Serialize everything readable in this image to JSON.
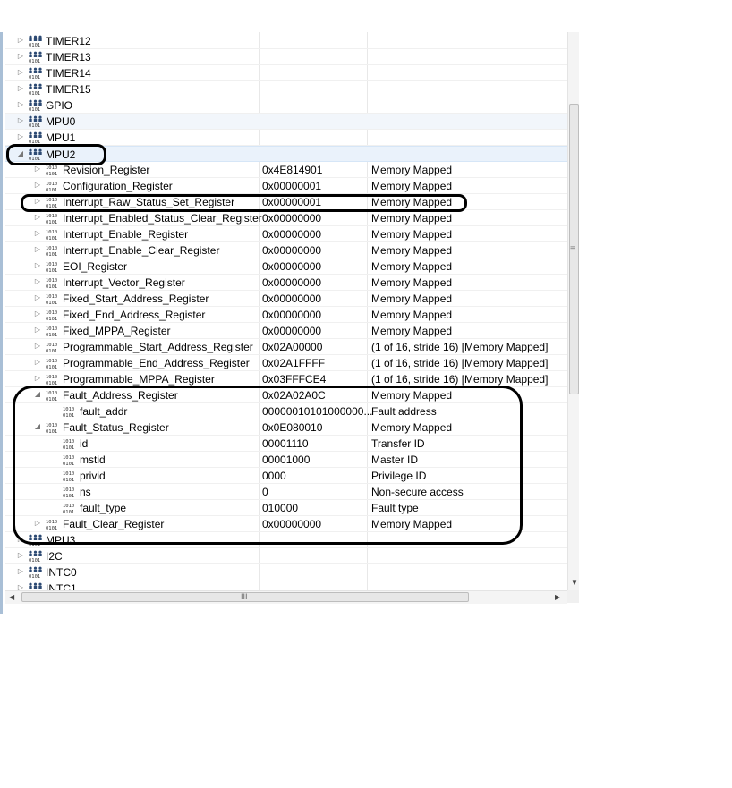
{
  "rows": [
    {
      "name": "TIMER12",
      "indent": 0,
      "icon": "peripheral-icon",
      "twisty": "collapsed",
      "value": "",
      "type": ""
    },
    {
      "name": "TIMER13",
      "indent": 0,
      "icon": "peripheral-icon",
      "twisty": "collapsed",
      "value": "",
      "type": ""
    },
    {
      "name": "TIMER14",
      "indent": 0,
      "icon": "peripheral-icon",
      "twisty": "collapsed",
      "value": "",
      "type": ""
    },
    {
      "name": "TIMER15",
      "indent": 0,
      "icon": "peripheral-icon",
      "twisty": "collapsed",
      "value": "",
      "type": ""
    },
    {
      "name": "GPIO",
      "indent": 0,
      "icon": "peripheral-icon",
      "twisty": "collapsed",
      "value": "",
      "type": ""
    },
    {
      "name": "MPU0",
      "indent": 0,
      "icon": "peripheral-icon",
      "twisty": "collapsed",
      "value": "",
      "type": "",
      "state": "hov"
    },
    {
      "name": "MPU1",
      "indent": 0,
      "icon": "peripheral-icon",
      "twisty": "collapsed",
      "value": "",
      "type": ""
    },
    {
      "name": "MPU2",
      "indent": 0,
      "icon": "peripheral-icon",
      "twisty": "expanded",
      "value": "",
      "type": "",
      "state": "sel"
    },
    {
      "name": "Revision_Register",
      "indent": 1,
      "icon": "register-icon",
      "twisty": "collapsed",
      "value": "0x4E814901",
      "type": "Memory Mapped"
    },
    {
      "name": "Configuration_Register",
      "indent": 1,
      "icon": "register-icon",
      "twisty": "collapsed",
      "value": "0x00000001",
      "type": "Memory Mapped"
    },
    {
      "name": "Interrupt_Raw_Status_Set_Register",
      "indent": 1,
      "icon": "register-icon",
      "twisty": "collapsed",
      "value": "0x00000001",
      "type": "Memory Mapped"
    },
    {
      "name": "Interrupt_Enabled_Status_Clear_Register",
      "indent": 1,
      "icon": "register-icon",
      "twisty": "collapsed",
      "value": "0x00000000",
      "type": "Memory Mapped"
    },
    {
      "name": "Interrupt_Enable_Register",
      "indent": 1,
      "icon": "register-icon",
      "twisty": "collapsed",
      "value": "0x00000000",
      "type": "Memory Mapped"
    },
    {
      "name": "Interrupt_Enable_Clear_Register",
      "indent": 1,
      "icon": "register-icon",
      "twisty": "collapsed",
      "value": "0x00000000",
      "type": "Memory Mapped"
    },
    {
      "name": "EOI_Register",
      "indent": 1,
      "icon": "register-icon",
      "twisty": "collapsed",
      "value": "0x00000000",
      "type": "Memory Mapped"
    },
    {
      "name": "Interrupt_Vector_Register",
      "indent": 1,
      "icon": "register-icon",
      "twisty": "collapsed",
      "value": "0x00000000",
      "type": "Memory Mapped"
    },
    {
      "name": "Fixed_Start_Address_Register",
      "indent": 1,
      "icon": "register-icon",
      "twisty": "collapsed",
      "value": "0x00000000",
      "type": "Memory Mapped"
    },
    {
      "name": "Fixed_End_Address_Register",
      "indent": 1,
      "icon": "register-icon",
      "twisty": "collapsed",
      "value": "0x00000000",
      "type": "Memory Mapped"
    },
    {
      "name": "Fixed_MPPA_Register",
      "indent": 1,
      "icon": "register-icon",
      "twisty": "collapsed",
      "value": "0x00000000",
      "type": "Memory Mapped"
    },
    {
      "name": "Programmable_Start_Address_Register",
      "indent": 1,
      "icon": "register-icon",
      "twisty": "collapsed",
      "value": "0x02A00000",
      "type": "(1 of 16, stride 16) [Memory Mapped]"
    },
    {
      "name": "Programmable_End_Address_Register",
      "indent": 1,
      "icon": "register-icon",
      "twisty": "collapsed",
      "value": "0x02A1FFFF",
      "type": "(1 of 16, stride 16) [Memory Mapped]"
    },
    {
      "name": "Programmable_MPPA_Register",
      "indent": 1,
      "icon": "register-icon",
      "twisty": "collapsed",
      "value": "0x03FFFCE4",
      "type": "(1 of 16, stride 16) [Memory Mapped]"
    },
    {
      "name": "Fault_Address_Register",
      "indent": 1,
      "icon": "register-icon",
      "twisty": "expanded",
      "value": "0x02A02A0C",
      "type": "Memory Mapped"
    },
    {
      "name": "fault_addr",
      "indent": 2,
      "icon": "bitfield-icon",
      "twisty": "none",
      "value": "00000010101000000...",
      "type": "Fault address"
    },
    {
      "name": "Fault_Status_Register",
      "indent": 1,
      "icon": "register-icon",
      "twisty": "expanded",
      "value": "0x0E080010",
      "type": "Memory Mapped"
    },
    {
      "name": "id",
      "indent": 2,
      "icon": "bitfield-icon",
      "twisty": "none",
      "value": "00001110",
      "type": "Transfer ID"
    },
    {
      "name": "mstid",
      "indent": 2,
      "icon": "bitfield-icon",
      "twisty": "none",
      "value": "00001000",
      "type": "Master ID"
    },
    {
      "name": "privid",
      "indent": 2,
      "icon": "bitfield-icon",
      "twisty": "none",
      "value": "0000",
      "type": "Privilege ID"
    },
    {
      "name": "ns",
      "indent": 2,
      "icon": "bitfield-icon",
      "twisty": "none",
      "value": "0",
      "type": "Non-secure access"
    },
    {
      "name": "fault_type",
      "indent": 2,
      "icon": "bitfield-icon",
      "twisty": "none",
      "value": "010000",
      "type": "Fault type"
    },
    {
      "name": "Fault_Clear_Register",
      "indent": 1,
      "icon": "register-icon",
      "twisty": "collapsed",
      "value": "0x00000000",
      "type": "Memory Mapped"
    },
    {
      "name": "MPU3",
      "indent": 0,
      "icon": "peripheral-icon",
      "twisty": "collapsed",
      "value": "",
      "type": ""
    },
    {
      "name": "I2C",
      "indent": 0,
      "icon": "peripheral-icon",
      "twisty": "collapsed",
      "value": "",
      "type": ""
    },
    {
      "name": "INTC0",
      "indent": 0,
      "icon": "peripheral-icon",
      "twisty": "collapsed",
      "value": "",
      "type": ""
    },
    {
      "name": "INTC1",
      "indent": 0,
      "icon": "peripheral-icon",
      "twisty": "collapsed",
      "value": "",
      "type": ""
    }
  ],
  "scrollbars": {
    "vertical_grip": "≡",
    "horizontal_grip": "III",
    "up_arrow": "▲",
    "down_arrow": "▼",
    "left_arrow": "◀",
    "right_arrow": "▶"
  },
  "colors": {
    "selection": "#eaf2fb",
    "annotation": "#000000",
    "panel_border": "#a9bfd6"
  }
}
